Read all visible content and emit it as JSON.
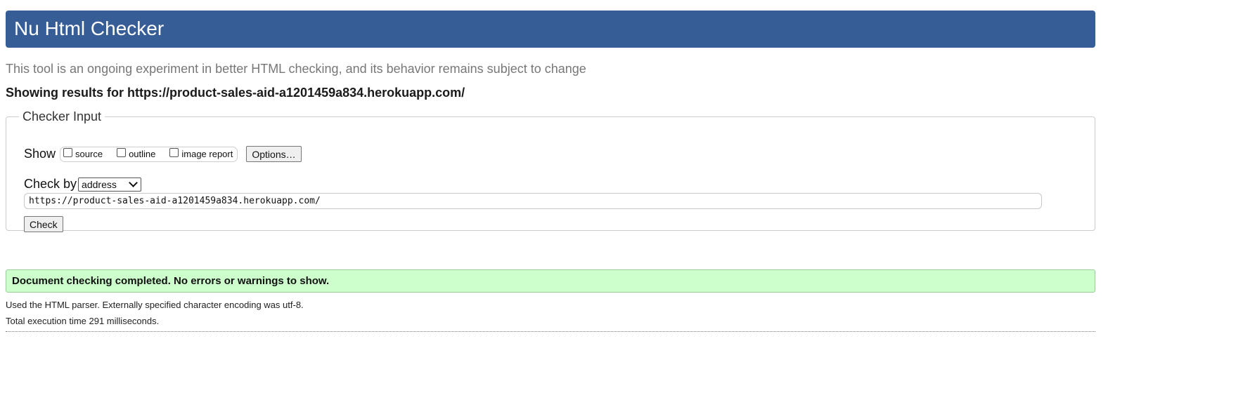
{
  "header": {
    "title": "Nu Html Checker"
  },
  "subtitle": "This tool is an ongoing experiment in better HTML checking, and its behavior remains subject to change",
  "results_for": "Showing results for https://product-sales-aid-a1201459a834.herokuapp.com/",
  "checker_input": {
    "legend": "Checker Input",
    "show_label": "Show",
    "show_options": [
      {
        "label": "source",
        "checked": false
      },
      {
        "label": "outline",
        "checked": false
      },
      {
        "label": "image report",
        "checked": false
      }
    ],
    "options_button": "Options…",
    "check_by_label": "Check by",
    "check_by_value": "address",
    "url_value": "https://product-sales-aid-a1201459a834.herokuapp.com/",
    "check_button": "Check"
  },
  "result": {
    "message": "Document checking completed. No errors or warnings to show.",
    "parser_note": "Used the HTML parser. Externally specified character encoding was utf-8.",
    "execution_time": "Total execution time 291 milliseconds."
  },
  "colors": {
    "header_bg": "#365d96",
    "success_bg": "#ccffcc",
    "success_border": "#99cc99"
  }
}
